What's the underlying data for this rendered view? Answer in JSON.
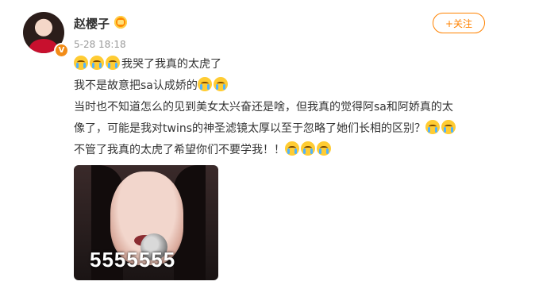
{
  "user": {
    "name": "赵樱子",
    "verified_badge": "V",
    "time": "5-28 18:18"
  },
  "follow_button": {
    "label": "+关注"
  },
  "post": {
    "line1": "我哭了我真的太虎了",
    "line2": "我不是故意把sa认成娇的",
    "line3": "当时也不知道怎么的见到美女太兴奋还是啥，但我真的觉得阿sa和阿娇真的太",
    "line4": "像了，可能是我对twins的神圣滤镜太厚以至于忽略了她们长相的区别？",
    "line5": "不管了我真的太虎了希望你们不要学我！！"
  },
  "media": {
    "caption": "5555555"
  },
  "colors": {
    "accent": "#ff8200",
    "text": "#333333",
    "muted": "#999999",
    "emoji": "#ffcc33"
  },
  "icons": {
    "emoji": "crying-face-icon",
    "badge": "verified-v-icon",
    "level": "crown-badge-icon"
  }
}
